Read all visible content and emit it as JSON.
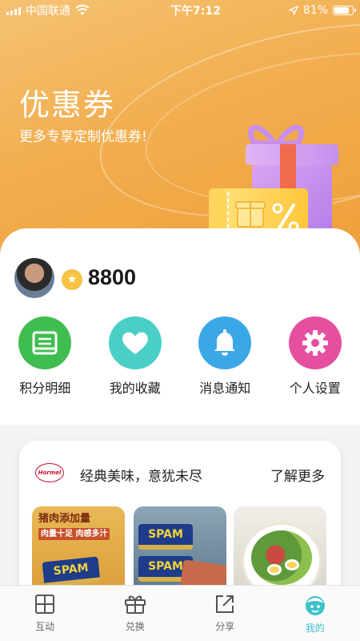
{
  "status_bar": {
    "carrier": "中国联通",
    "time": "下午7:12",
    "battery": "81%",
    "battery_level": 0.81
  },
  "hero": {
    "title": "优惠券",
    "subtitle": "更多专享定制优惠券!"
  },
  "profile": {
    "points": "8800"
  },
  "menu": {
    "items": [
      {
        "label": "积分明细",
        "icon": "ledger-icon",
        "color": "#3fbe4f"
      },
      {
        "label": "我的收藏",
        "icon": "heart-icon",
        "color": "#49cfc5"
      },
      {
        "label": "消息通知",
        "icon": "bell-icon",
        "color": "#3aa8e6"
      },
      {
        "label": "个人设置",
        "icon": "gear-icon",
        "color": "#e64fa0"
      }
    ]
  },
  "promo": {
    "brand_logo_text": "Hormel",
    "title": "经典美味，意犹未尽",
    "more": "了解更多",
    "thumb1_caption": "猪肉添加量",
    "thumb1_sub": "肉量十足 肉感多汁",
    "can_text": "SPAM"
  },
  "tab_bar": {
    "tabs": [
      {
        "label": "互动",
        "icon": "grid-icon"
      },
      {
        "label": "兑换",
        "icon": "gift-box-icon"
      },
      {
        "label": "分享",
        "icon": "share-icon"
      },
      {
        "label": "我的",
        "icon": "face-icon",
        "active": true
      }
    ]
  },
  "colors": {
    "hero_orange": "#f2ae4f",
    "active_teal": "#3cc2c9",
    "coin_gold": "#f6c343"
  }
}
